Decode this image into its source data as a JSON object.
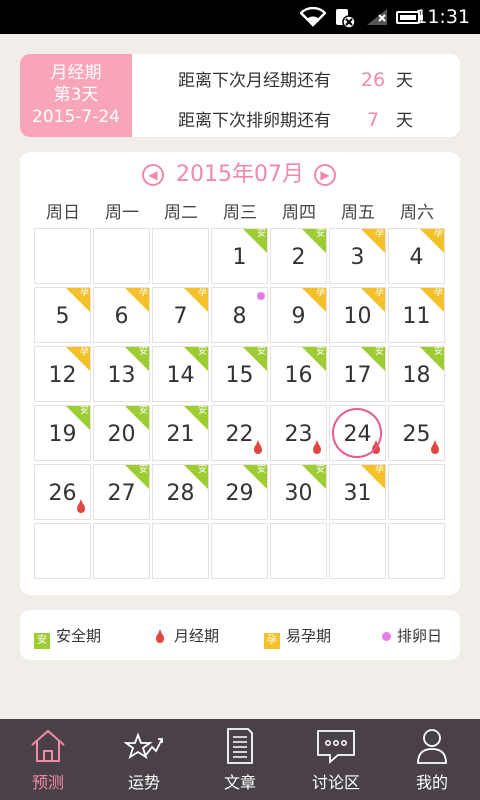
{
  "status_bar": {
    "time": "11:31"
  },
  "info": {
    "period_title": "月经期",
    "period_day": "第3天",
    "period_date": "2015-7-24",
    "next_period_label": "距离下次月经期还有",
    "next_period_days": "26",
    "next_ovulation_label": "距离下次排卵期还有",
    "next_ovulation_days": "7",
    "unit": "天"
  },
  "calendar": {
    "month_title": "2015年07月",
    "prev_icon": "chevron-left-icon",
    "next_icon": "chevron-right-icon",
    "weekdays": [
      "周日",
      "周一",
      "周二",
      "周三",
      "周四",
      "周五",
      "周六"
    ],
    "tag_safe": "安",
    "tag_preg": "孕",
    "today": "24",
    "days": [
      {
        "d": "1",
        "col": 3,
        "row": 0,
        "tag": "safe"
      },
      {
        "d": "2",
        "col": 4,
        "row": 0,
        "tag": "safe"
      },
      {
        "d": "3",
        "col": 5,
        "row": 0,
        "tag": "preg"
      },
      {
        "d": "4",
        "col": 6,
        "row": 0,
        "tag": "preg"
      },
      {
        "d": "5",
        "col": 0,
        "row": 1,
        "tag": "preg"
      },
      {
        "d": "6",
        "col": 1,
        "row": 1,
        "tag": "preg"
      },
      {
        "d": "7",
        "col": 2,
        "row": 1,
        "tag": "preg"
      },
      {
        "d": "8",
        "col": 3,
        "row": 1,
        "tag": "",
        "ovulation": true
      },
      {
        "d": "9",
        "col": 4,
        "row": 1,
        "tag": "preg"
      },
      {
        "d": "10",
        "col": 5,
        "row": 1,
        "tag": "preg"
      },
      {
        "d": "11",
        "col": 6,
        "row": 1,
        "tag": "preg"
      },
      {
        "d": "12",
        "col": 0,
        "row": 2,
        "tag": "preg"
      },
      {
        "d": "13",
        "col": 1,
        "row": 2,
        "tag": "safe"
      },
      {
        "d": "14",
        "col": 2,
        "row": 2,
        "tag": "safe"
      },
      {
        "d": "15",
        "col": 3,
        "row": 2,
        "tag": "safe"
      },
      {
        "d": "16",
        "col": 4,
        "row": 2,
        "tag": "safe"
      },
      {
        "d": "17",
        "col": 5,
        "row": 2,
        "tag": "safe"
      },
      {
        "d": "18",
        "col": 6,
        "row": 2,
        "tag": "safe"
      },
      {
        "d": "19",
        "col": 0,
        "row": 3,
        "tag": "safe"
      },
      {
        "d": "20",
        "col": 1,
        "row": 3,
        "tag": "safe"
      },
      {
        "d": "21",
        "col": 2,
        "row": 3,
        "tag": "safe"
      },
      {
        "d": "22",
        "col": 3,
        "row": 3,
        "tag": "",
        "period": true
      },
      {
        "d": "23",
        "col": 4,
        "row": 3,
        "tag": "",
        "period": true
      },
      {
        "d": "24",
        "col": 5,
        "row": 3,
        "tag": "",
        "period": true
      },
      {
        "d": "25",
        "col": 6,
        "row": 3,
        "tag": "",
        "period": true
      },
      {
        "d": "26",
        "col": 0,
        "row": 4,
        "tag": "",
        "period": true
      },
      {
        "d": "27",
        "col": 1,
        "row": 4,
        "tag": "safe"
      },
      {
        "d": "28",
        "col": 2,
        "row": 4,
        "tag": "safe"
      },
      {
        "d": "29",
        "col": 3,
        "row": 4,
        "tag": "safe"
      },
      {
        "d": "30",
        "col": 4,
        "row": 4,
        "tag": "safe"
      },
      {
        "d": "31",
        "col": 5,
        "row": 4,
        "tag": "preg"
      }
    ]
  },
  "legend": {
    "safe": "安全期",
    "period": "月经期",
    "fertile": "易孕期",
    "ovulation": "排卵日"
  },
  "nav": {
    "items": [
      {
        "label": "预测",
        "icon": "house-icon",
        "active": true
      },
      {
        "label": "运势",
        "icon": "star-chart-icon",
        "active": false
      },
      {
        "label": "文章",
        "icon": "document-icon",
        "active": false
      },
      {
        "label": "讨论区",
        "icon": "chat-bubble-icon",
        "active": false
      },
      {
        "label": "我的",
        "icon": "person-icon",
        "active": false
      }
    ]
  },
  "colors": {
    "accent": "#f08aa6",
    "safe": "#9ecc33",
    "fertile": "#f5c12b",
    "period": "#e0473f",
    "ovulation": "#e67be5",
    "nav_bg": "#4a4148"
  }
}
